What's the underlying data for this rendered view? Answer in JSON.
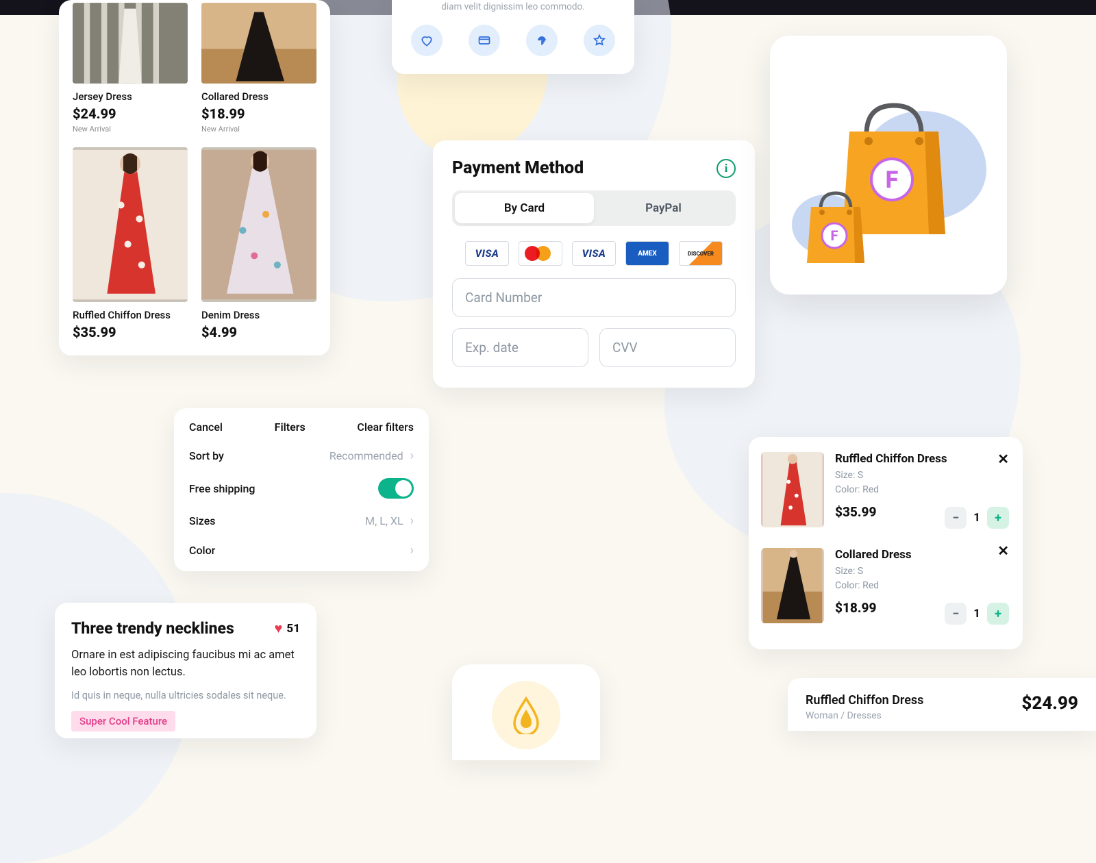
{
  "products": [
    {
      "name": "Jersey Dress",
      "price": "$24.99",
      "tag": "New Arrival"
    },
    {
      "name": "Collared Dress",
      "price": "$18.99",
      "tag": "New Arrival"
    },
    {
      "name": "Ruffled Chiffon Dress",
      "price": "$35.99",
      "tag": ""
    },
    {
      "name": "Denim Dress",
      "price": "$4.99",
      "tag": ""
    }
  ],
  "top_card": {
    "lorem": "diam velit dignissim leo commodo."
  },
  "payment": {
    "title": "Payment Method",
    "tab_card": "By Card",
    "tab_paypal": "PayPal",
    "card_number_ph": "Card Number",
    "exp_ph": "Exp. date",
    "cvv_ph": "CVV"
  },
  "filters": {
    "cancel": "Cancel",
    "title": "Filters",
    "clear": "Clear filters",
    "sort_label": "Sort by",
    "sort_value": "Recommended",
    "free_shipping": "Free shipping",
    "sizes_label": "Sizes",
    "sizes_value": "M, L, XL",
    "color_label": "Color"
  },
  "cart": [
    {
      "name": "Ruffled Chiffon Dress",
      "size": "Size: S",
      "color": "Color: Red",
      "price": "$35.99",
      "qty": "1"
    },
    {
      "name": "Collared Dress",
      "size": "Size: S",
      "color": "Color: Red",
      "price": "$18.99",
      "qty": "1"
    }
  ],
  "article": {
    "title": "Three trendy necklines",
    "likes": "51",
    "body": "Ornare in est adipiscing faucibus mi ac amet leo lobortis non lectus.",
    "sub": "Id quis in neque, nulla ultricies sodales sit neque.",
    "pill": "Super Cool Feature"
  },
  "prodbar": {
    "name": "Ruffled Chiffon Dress",
    "category": "Woman / Dresses",
    "price": "$24.99"
  }
}
